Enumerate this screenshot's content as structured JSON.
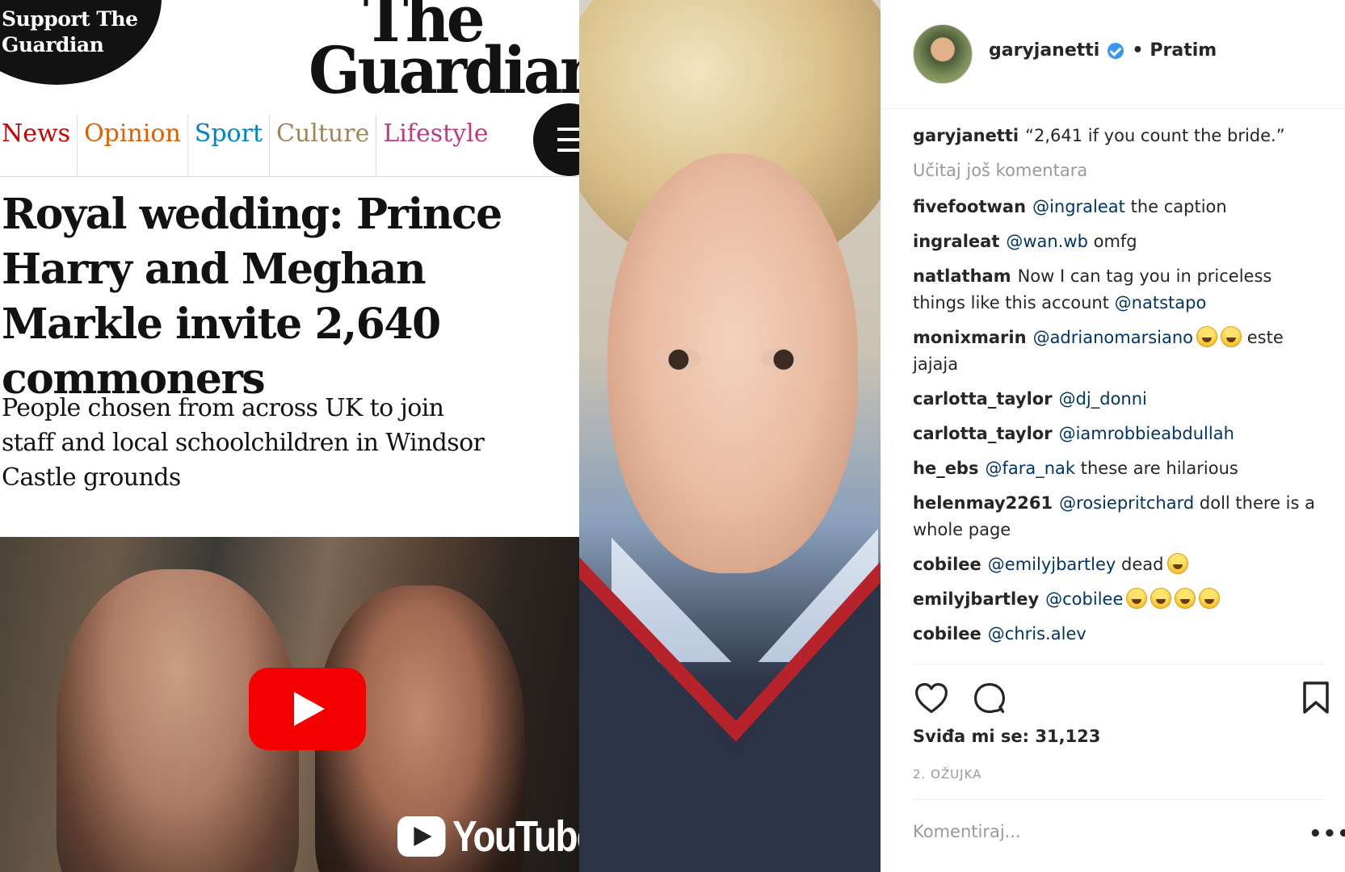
{
  "guardian": {
    "support_text": "Support The Guardian",
    "logo_line1": "The",
    "logo_line2": "Guardian",
    "nav": [
      {
        "label": "News",
        "color": "#c70000"
      },
      {
        "label": "Opinion",
        "color": "#e05e00"
      },
      {
        "label": "Sport",
        "color": "#0084c6"
      },
      {
        "label": "Culture",
        "color": "#a1845c"
      },
      {
        "label": "Lifestyle",
        "color": "#bb3b80"
      }
    ],
    "headline": "Royal wedding: Prince Harry and Meghan Markle invite 2,640 commoners",
    "standfirst": "People chosen from across UK to join staff and local schoolchildren in Windsor Castle grounds",
    "video_brand": "YouTube"
  },
  "instagram": {
    "username": "garyjanetti",
    "separator": "•",
    "follow_status": "Pratim",
    "caption_user": "garyjanetti",
    "caption_text": "“2,641 if you count the bride.”",
    "load_more": "Učitaj još komentara",
    "comments": [
      {
        "user": "fivefootwan",
        "mention": "@ingraleat",
        "text": "the caption",
        "emoji": 0
      },
      {
        "user": "ingraleat",
        "mention": "@wan.wb",
        "text": "omfg",
        "emoji": 0
      },
      {
        "user": "natlatham",
        "mention": "",
        "text": "Now I can tag you in priceless things like this account",
        "mention_after": "@natstapo",
        "emoji": 0
      },
      {
        "user": "monixmarin",
        "mention": "@adrianomarsiano",
        "text": "este jajaja",
        "emoji": 2
      },
      {
        "user": "carlotta_taylor",
        "mention": "@dj_donni",
        "text": "",
        "emoji": 0
      },
      {
        "user": "carlotta_taylor",
        "mention": "@iamrobbieabdullah",
        "text": "",
        "emoji": 0
      },
      {
        "user": "he_ebs",
        "mention": "@fara_nak",
        "text": "these are hilarious",
        "emoji": 0
      },
      {
        "user": "helenmay2261",
        "mention": "@rosiepritchard",
        "text": "doll there is a whole page",
        "emoji": 0
      },
      {
        "user": "cobilee",
        "mention": "@emilyjbartley",
        "text": "dead",
        "emoji": 1
      },
      {
        "user": "emilyjbartley",
        "mention": "@cobilee",
        "text": "",
        "emoji": 4
      },
      {
        "user": "cobilee",
        "mention": "@chris.alev",
        "text": "",
        "emoji": 0
      }
    ],
    "likes": "Sviđa mi se: 31,123",
    "date": "2. OŽUJKA",
    "comment_placeholder": "Komentiraj...",
    "more": "•••",
    "icons": {
      "like": "heart-icon",
      "comment": "comment-bubble-icon",
      "save": "bookmark-icon",
      "verified": "verified-badge-icon",
      "more": "more-options-icon"
    }
  }
}
